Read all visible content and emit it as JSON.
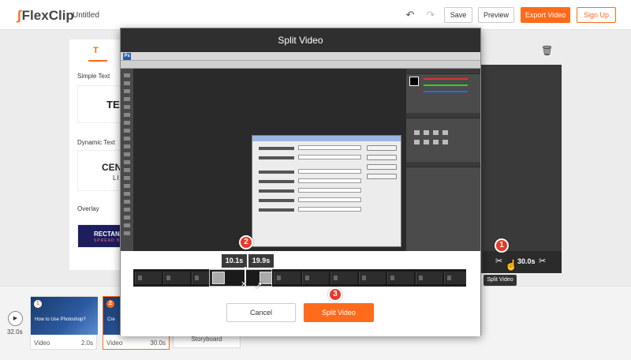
{
  "app": {
    "logo": "FlexClip",
    "doc_title": "Untitled"
  },
  "header": {
    "save_label": "Save",
    "preview_label": "Preview",
    "export_label": "Export Video",
    "signup_label": "Sign Up"
  },
  "panel": {
    "tab_icon": "T",
    "sections": [
      {
        "label": "Simple Text",
        "sample": "TEXT"
      },
      {
        "label": "Dynamic Text",
        "sample": "CENTI",
        "sub": "LINE"
      },
      {
        "label": "Overlay",
        "sample": "RECTANG",
        "sub": "SPREAD B"
      }
    ]
  },
  "modal": {
    "title": "Split Video",
    "time_left": "10.1s",
    "time_right": "19.9s",
    "cancel_label": "Cancel",
    "split_label": "Split Video"
  },
  "video_strip": {
    "duration": "30.0s",
    "tooltip": "Split Video"
  },
  "timeline": {
    "total_time": "32.0s",
    "clips": [
      {
        "number": "1",
        "caption": "How to Use Photoshop?",
        "type": "Video",
        "duration": "2.0s"
      },
      {
        "number": "2",
        "caption": "Cre",
        "type": "Video",
        "duration": "30.0s"
      }
    ],
    "storyboard_label": "Storyboard"
  },
  "badges": [
    "1",
    "2",
    "3"
  ],
  "colors": {
    "accent": "#ff6b1a",
    "badge": "#e8392b",
    "modal_header": "#2f2f2f"
  }
}
